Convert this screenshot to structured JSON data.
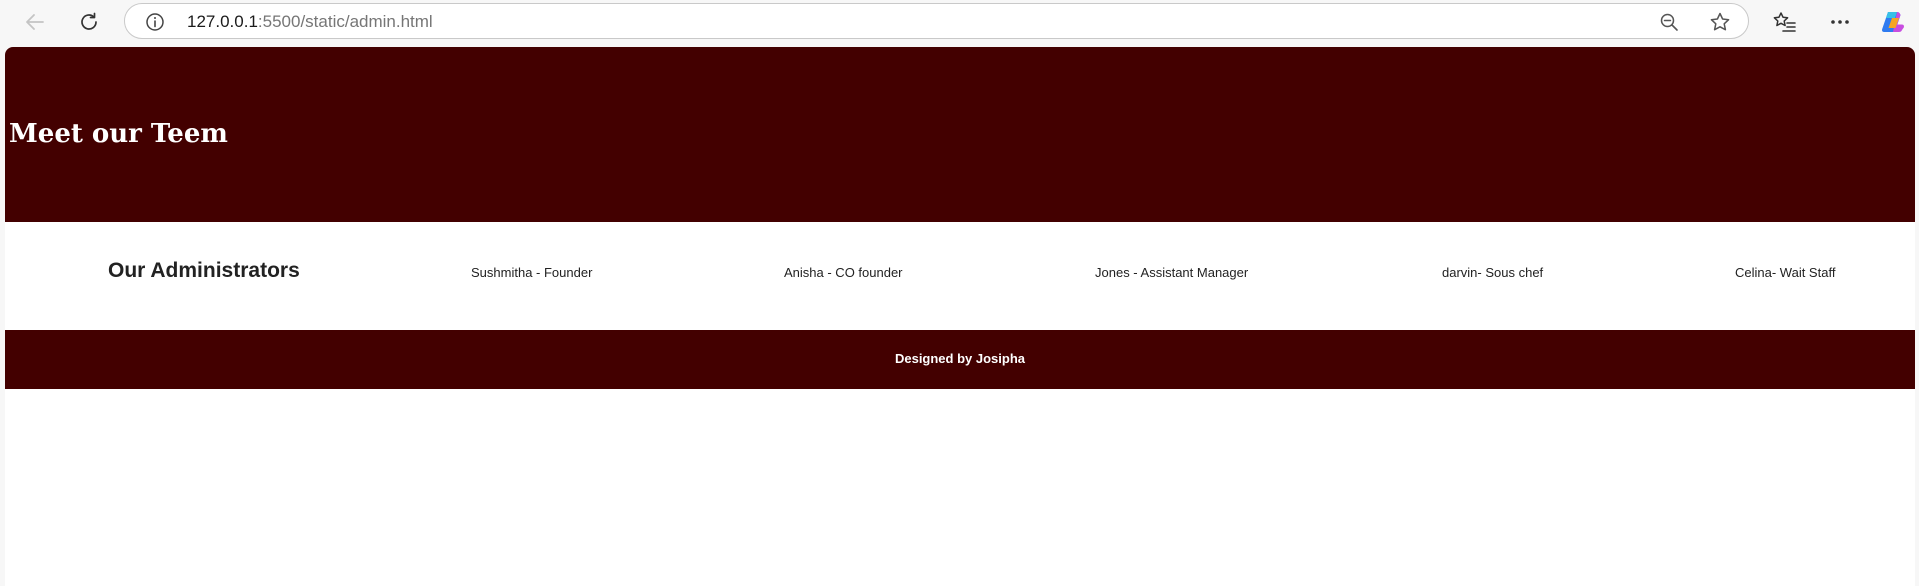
{
  "browser": {
    "url_host": "127.0.0.1",
    "url_path": ":5500/static/admin.html",
    "icons": {
      "back": "back-arrow-icon",
      "reload": "reload-icon",
      "site_info": "info-icon",
      "zoom": "zoom-out-icon",
      "favorite": "star-icon",
      "favorites_bar": "favorites-icon",
      "menu": "more-icon",
      "copilot": "copilot-icon"
    }
  },
  "page": {
    "hero_title": "Meet our Teem",
    "admins_heading": "Our Administrators",
    "admins": [
      "Sushmitha - Founder",
      "Anisha - CO founder",
      "Jones - Assistant Manager",
      "darvin- Sous chef",
      "Celina- Wait Staff"
    ],
    "footer_text": "Designed by Josipha"
  },
  "colors": {
    "brand_maroon": "#430000",
    "page_background": "#ffffff",
    "chrome_background": "#f7f7f7"
  }
}
